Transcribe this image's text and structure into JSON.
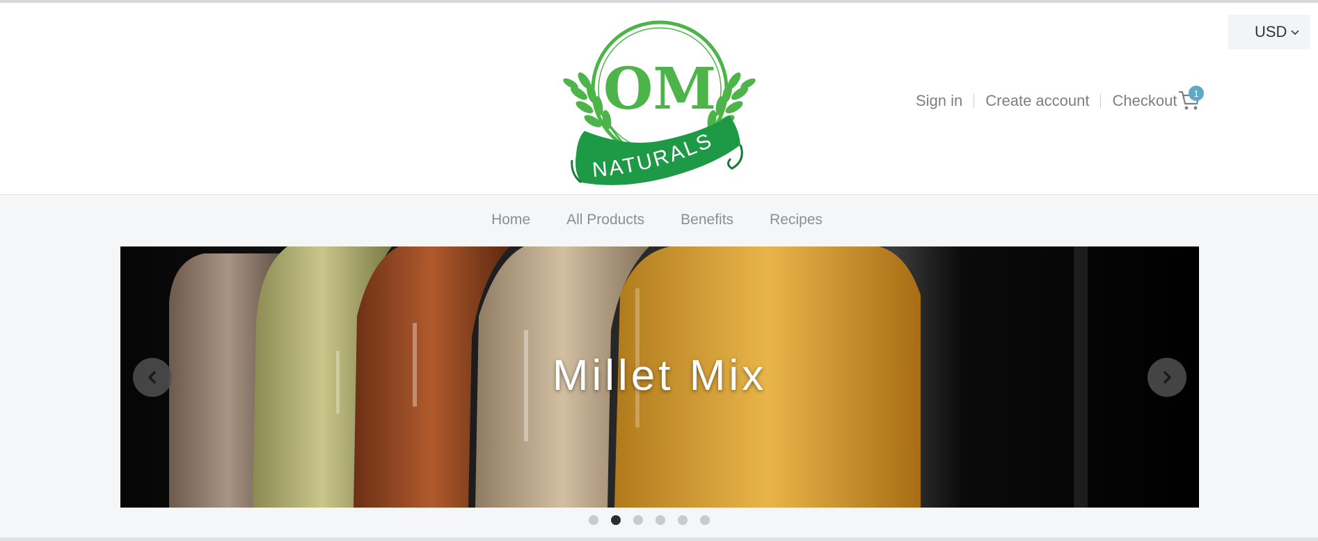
{
  "brand": {
    "logo_top_text": "OM",
    "logo_ribbon_text": "NATURALS",
    "colors": {
      "light_green": "#4cb448",
      "dark_green": "#1e9a46"
    }
  },
  "currency": {
    "selected": "USD",
    "icon": "chevron-down-icon"
  },
  "account": {
    "sign_in": "Sign in",
    "create_account": "Create account",
    "checkout": "Checkout"
  },
  "cart": {
    "icon": "cart-icon",
    "count": "1",
    "badge_color": "#5fa8c7"
  },
  "nav": {
    "items": [
      {
        "label": "Home"
      },
      {
        "label": "All Products"
      },
      {
        "label": "Benefits"
      },
      {
        "label": "Recipes"
      }
    ]
  },
  "hero": {
    "title": "Millet Mix",
    "prev_icon": "chevron-left-icon",
    "next_icon": "chevron-right-icon",
    "slide_count": 6,
    "active_slide": 2
  }
}
